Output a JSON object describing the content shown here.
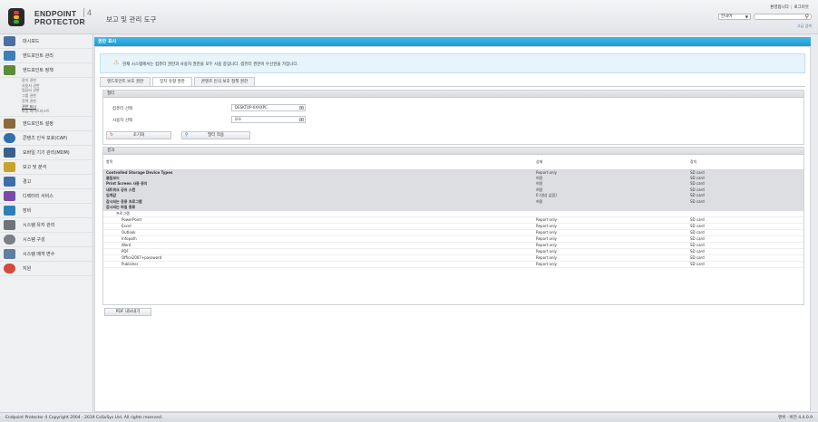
{
  "header": {
    "logo_line1": "ENDPOINT",
    "logo_line2": "PROTECTOR",
    "logo_version": "4",
    "title": "보고 및 관리 도구",
    "link_user": "환영합니다",
    "link_logout": "로그아웃",
    "language": "한국어",
    "search_placeholder": "",
    "advanced_search": "고급 검색"
  },
  "sidebar": {
    "items": [
      {
        "label": "대시보드",
        "icon": "dashboard-icon",
        "color": "#4a6fa5"
      },
      {
        "label": "엔드포인트 관리",
        "icon": "monitor-icon",
        "color": "#3b7fb6"
      },
      {
        "label": "엔드포인트 정책",
        "icon": "policy-icon",
        "color": "#5a8c3a"
      },
      {
        "label": "엔드포인트 설정",
        "icon": "tools-icon",
        "color": "#8a6a3a"
      },
      {
        "label": "콘텐츠 인식 보호(CAP)",
        "icon": "cap-icon",
        "color": "#2f6fb0"
      },
      {
        "label": "모바일 기기 관리(MDM)",
        "icon": "mobile-icon",
        "color": "#3a5f8c"
      },
      {
        "label": "보고 및 분석",
        "icon": "report-icon",
        "color": "#c8a22a"
      },
      {
        "label": "경고",
        "icon": "alert-icon",
        "color": "#3c6ea8"
      },
      {
        "label": "디렉터리 서비스",
        "icon": "directory-icon",
        "color": "#7a4aa8"
      },
      {
        "label": "장비",
        "icon": "appliance-icon",
        "color": "#2e7fb8"
      },
      {
        "label": "시스템 유지 관리",
        "icon": "maintenance-icon",
        "color": "#6f7379"
      },
      {
        "label": "시스템 구성",
        "icon": "config-icon",
        "color": "#7c8086"
      },
      {
        "label": "시스템 매개 변수",
        "icon": "parameters-icon",
        "color": "#5f7fa0"
      },
      {
        "label": "지원",
        "icon": "support-icon",
        "color": "#d44a3a"
      }
    ],
    "policy_subitems": [
      "장치 권한",
      "사용자 권한",
      "컴퓨터 권한",
      "그룹 권한",
      "전역 권한",
      "권한 표시",
      "파일 화이트리스트"
    ]
  },
  "main": {
    "title": "권한 표시",
    "notice": "현재 시스템에서는 컴퓨터 권한과 사용자 권한을 모두 사용 중입니다. 컴퓨터 권한이 우선권을 가집니다.",
    "tabs": [
      "엔드포인트 보호 권한",
      "장치 유형 권한",
      "콘텐츠 인식 보호 정책 권한"
    ],
    "filter": {
      "heading": "필터",
      "computer_label": "컴퓨터 선택",
      "computer_value": "DESKTOP-XXXXPC",
      "user_label": "사용자 선택",
      "user_value": "모두",
      "reset_button": "초기화",
      "apply_button": "필터 적용"
    },
    "results": {
      "heading": "결과",
      "columns": [
        "항목",
        "상태",
        "장치"
      ],
      "rows": [
        {
          "style": "grey bold",
          "name": "Controlled Storage Device Types",
          "status": "Report only",
          "device": "SD card"
        },
        {
          "style": "grey bold",
          "name": "클립보드",
          "status": "허용",
          "device": "SD card"
        },
        {
          "style": "grey bold",
          "name": "Print Screen 사용 중지",
          "status": "허용",
          "device": "SD card"
        },
        {
          "style": "grey bold",
          "name": "네트워크 공유 스캔",
          "status": "허용",
          "device": "SD card"
        },
        {
          "style": "grey bold",
          "name": "임계값",
          "status": "0 (영상 없음)",
          "device": "SD card"
        },
        {
          "style": "grey bold",
          "name": "감시되는 응용 프로그램",
          "status": "허용",
          "device": "SD card"
        },
        {
          "style": "grey bold",
          "name": "감시되는 파일 종류",
          "status": "",
          "device": ""
        },
        {
          "style": "lite sub",
          "name": "프로그램",
          "status": "",
          "device": ""
        },
        {
          "style": "lite sub2",
          "name": "PowerPoint",
          "status": "Report only",
          "device": "SD card"
        },
        {
          "style": "lite sub2",
          "name": "Excel",
          "status": "Report only",
          "device": "SD card"
        },
        {
          "style": "lite sub2",
          "name": "Outlook",
          "status": "Report only",
          "device": "SD card"
        },
        {
          "style": "lite sub2",
          "name": "Infopath",
          "status": "Report only",
          "device": "SD card"
        },
        {
          "style": "lite sub2",
          "name": "Word",
          "status": "Report only",
          "device": "SD card"
        },
        {
          "style": "lite sub2",
          "name": "PDF",
          "status": "Report only",
          "device": "SD card"
        },
        {
          "style": "lite sub2",
          "name": "Office2007+password",
          "status": "Report only",
          "device": "SD card"
        },
        {
          "style": "lite sub2",
          "name": "Publisher",
          "status": "Report only",
          "device": "SD card"
        }
      ]
    },
    "pdf_button": "PDF 내보내기"
  },
  "footer": {
    "copyright": "Endpoint Protector 4 Copyright 2004 - 2019 CoSoSys Ltd. All rights reserved.",
    "version": "맨위 · 버전 4.4.0.9"
  }
}
